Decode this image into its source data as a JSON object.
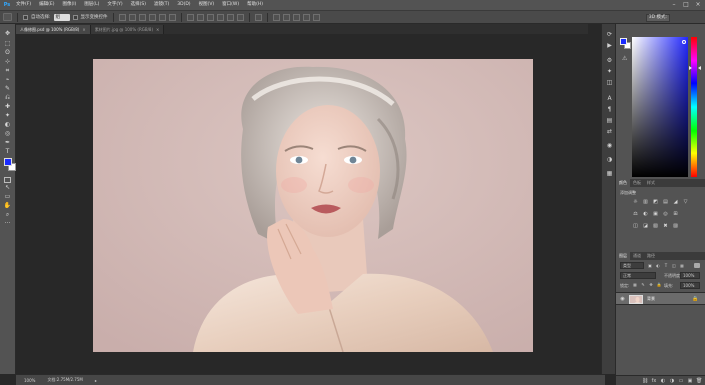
{
  "app": {
    "logo": "Ps"
  },
  "menu": [
    "文件(F)",
    "编辑(E)",
    "图像(I)",
    "图层(L)",
    "文字(Y)",
    "选择(S)",
    "滤镜(T)",
    "3D(D)",
    "视图(V)",
    "窗口(W)",
    "帮助(H)"
  ],
  "window_controls": {
    "minimize": "–",
    "maximize": "□",
    "close": "×"
  },
  "options": {
    "auto_select_label": "自动选择:",
    "auto_select_value": "组",
    "show_transform_label": "显示变换控件",
    "mode_label": "3D 模式:"
  },
  "tabs": [
    {
      "label": "人像修图.psd @ 100% (RGB/8)",
      "active": true
    },
    {
      "label": "素材图片.jpg @ 100% (RGB/8)",
      "active": false
    }
  ],
  "tool_glyphs": [
    "✥",
    "⬚",
    "ʘ",
    "⊹",
    "⌗",
    "⌁",
    "✎",
    "⎌",
    "✚",
    "✦",
    "◐",
    "◎",
    "✒",
    "T",
    "↖",
    "▭",
    "✋",
    "⌕",
    "···"
  ],
  "colors": {
    "foreground": "#1a2bff",
    "background": "#ffffff"
  },
  "status": {
    "zoom": "100%",
    "doc_info": "文档:2.75M/2.75M",
    "arrow": "▸"
  },
  "strip_icons": [
    "⟳",
    "▶",
    "⚙",
    "✦",
    "◫",
    "A",
    "¶",
    "▤",
    "⇄",
    "◉",
    "◑",
    "▦",
    "✎",
    "⌂",
    "≣",
    "◇",
    "⊕"
  ],
  "color_panel": {
    "gamut_icon": "⚠"
  },
  "panel_groups": {
    "top": [
      "颜色",
      "色板",
      "样式"
    ],
    "middle": [
      "调整"
    ],
    "bottom": [
      "图层",
      "通道",
      "路径"
    ]
  },
  "adjustments": {
    "title": "添加调整",
    "row1": [
      "☼",
      "▥",
      "◩",
      "▤",
      "◢",
      "▽"
    ],
    "row2": [
      "⚖",
      "◐",
      "▣",
      "◎",
      "⊞"
    ],
    "row3": [
      "◫",
      "◪",
      "▧",
      "✖",
      "▨"
    ]
  },
  "layers": {
    "filter_label": "类型",
    "filter_icons": [
      "▣",
      "◐",
      "T",
      "◫",
      "▦"
    ],
    "blend_mode": "正常",
    "opacity_label": "不透明度:",
    "opacity_value": "100%",
    "lock_label": "锁定:",
    "lock_icons": [
      "▦",
      "✎",
      "✥",
      "🔒"
    ],
    "fill_label": "填充:",
    "fill_value": "100%",
    "items": [
      {
        "name": "背景",
        "visible_icon": "◉",
        "lock_icon": "🔒"
      }
    ],
    "footer_icons": [
      "⛓",
      "fx",
      "◐",
      "◑",
      "▭",
      "▣",
      "🗑"
    ]
  }
}
